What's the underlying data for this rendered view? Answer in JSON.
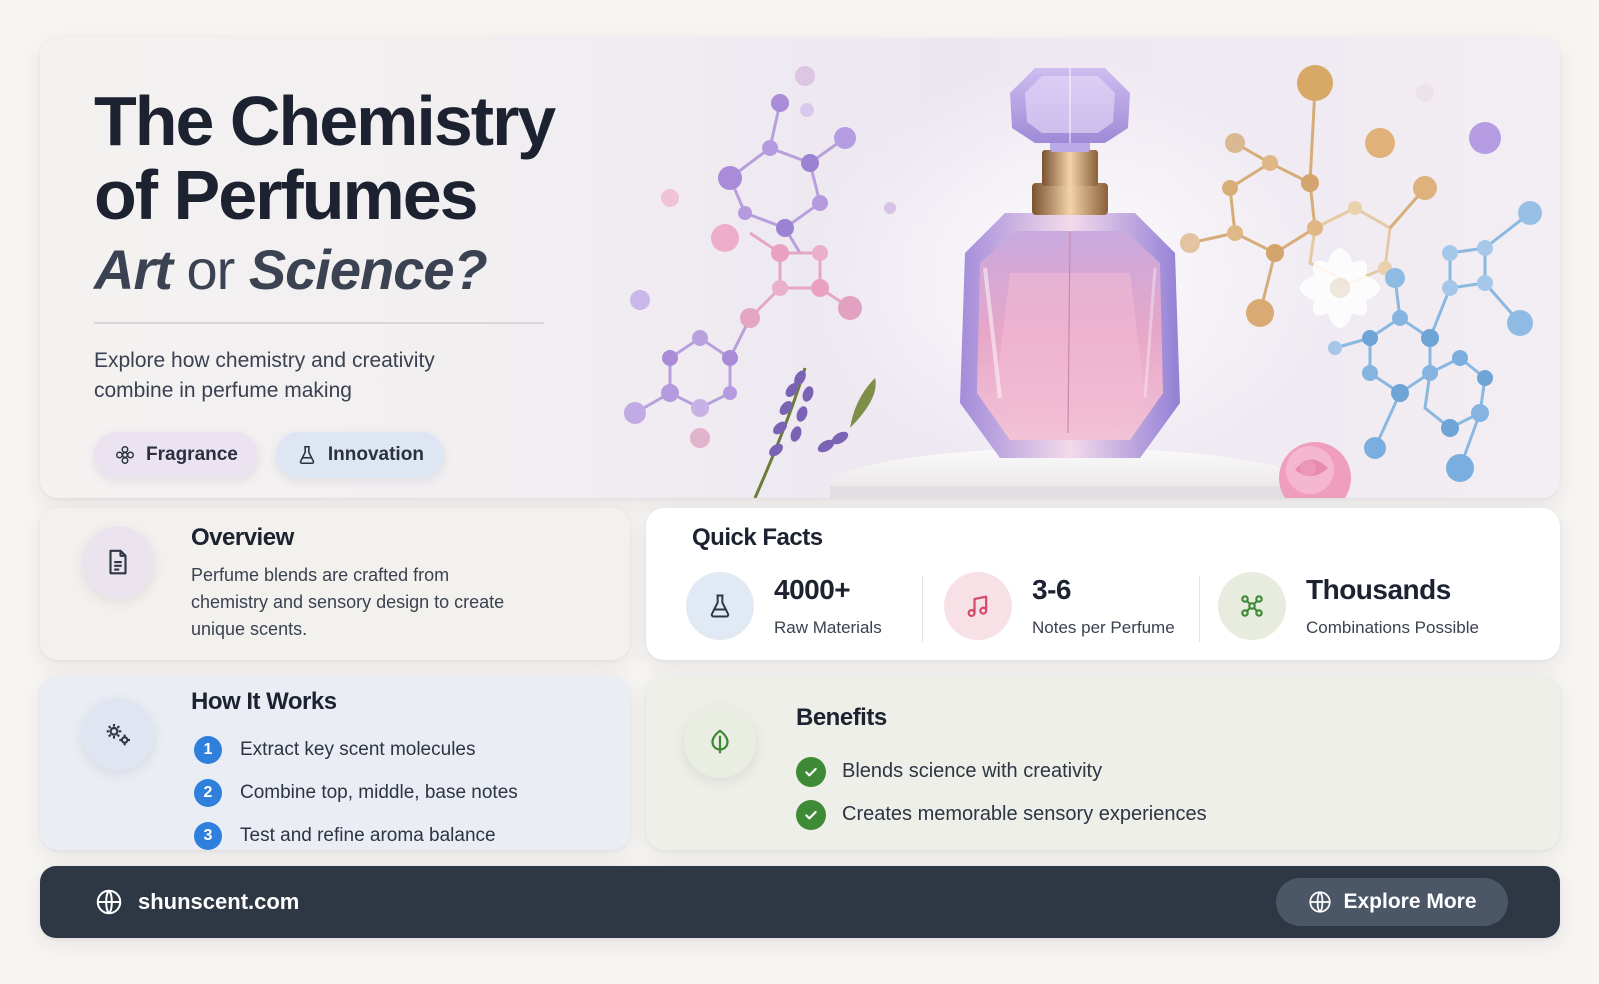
{
  "hero": {
    "title": "The Chemistry of Perfumes",
    "subtitle_art": "Art",
    "subtitle_or": "or",
    "subtitle_science": "Science?",
    "description": "Explore how chemistry and creativity combine in perfume making",
    "tags": [
      {
        "label": "Fragrance",
        "icon": "flower-icon"
      },
      {
        "label": "Innovation",
        "icon": "flask-icon"
      }
    ]
  },
  "overview": {
    "title": "Overview",
    "text": "Perfume blends are crafted from chemistry and sensory design to create unique scents.",
    "icon": "document-icon"
  },
  "quick_facts": {
    "title": "Quick Facts",
    "items": [
      {
        "value": "4000+",
        "label": "Raw Materials",
        "icon": "flask-icon"
      },
      {
        "value": "3-6",
        "label": "Notes per Perfume",
        "icon": "music-note-icon"
      },
      {
        "value": "Thousands",
        "label": "Combinations Possible",
        "icon": "molecule-icon"
      }
    ]
  },
  "how_it_works": {
    "title": "How It Works",
    "icon": "gears-icon",
    "steps": [
      {
        "num": "1",
        "text": "Extract key scent molecules"
      },
      {
        "num": "2",
        "text": "Combine top, middle, base notes"
      },
      {
        "num": "3",
        "text": "Test and refine aroma balance"
      }
    ]
  },
  "benefits": {
    "title": "Benefits",
    "icon": "leaf-icon",
    "items": [
      "Blends science with creativity",
      "Creates memorable sensory experiences"
    ]
  },
  "footer": {
    "site": "shunscent.com",
    "button_label": "Explore More"
  },
  "colors": {
    "accent_blue": "#2f7fdc",
    "check_green": "#3f8a36",
    "footer_dark": "#2e3744",
    "perfume_pink": "#e9a6c8",
    "molecule_purple": "#9a80d6",
    "molecule_gold": "#d2a46a",
    "molecule_blue": "#6fa6d8"
  }
}
